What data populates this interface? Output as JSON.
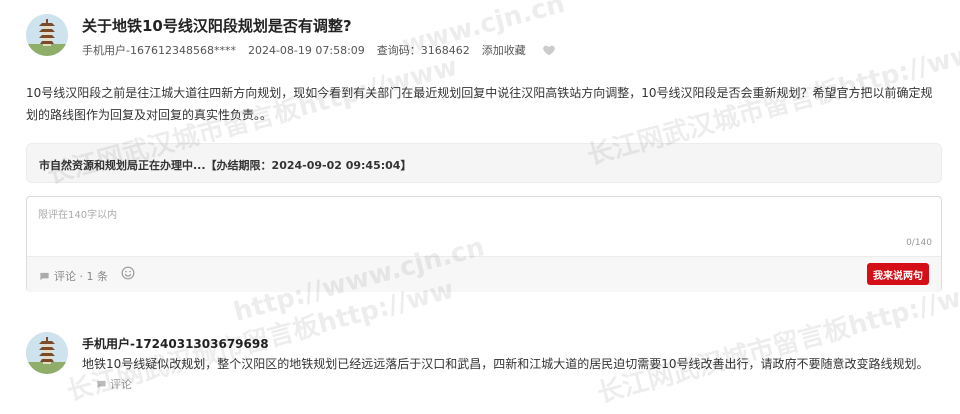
{
  "post": {
    "title": "关于地铁10号线汉阳段规划是否有调整?",
    "author": "手机用户-167612348568****",
    "date": "2024-08-19 07:58:09",
    "query_code_label": "查询码：",
    "query_code": "3168462",
    "favorite_label": "添加收藏",
    "body": "10号线汉阳段之前是往江城大道往四新方向规划，现如今看到有关部门在最近规划回复中说往汉阳高铁站方向调整，10号线汉阳段是否会重新规划？希望官方把以前确定规划的路线图作为回复及对回复的真实性负责。。",
    "status": "市自然资源和规划局正在办理中...【办结期限：2024-09-02 09:45:04】"
  },
  "comment_form": {
    "placeholder": "限评在140字以内",
    "value": "",
    "counter": "0/140",
    "comment_count": "评论 · 1 条",
    "submit_label": "我来说两句"
  },
  "replies": [
    {
      "user": "手机用户-1724031303679698",
      "text": "地铁10号线疑似改规划，整个汉阳区的地铁规划已经远远落后于汉口和武昌，四新和江城大道的居民迫切需要10号线改善出行，请政府不要随意改变路线规划。",
      "comment_label": "评论"
    }
  ],
  "watermarks": [
    "www.cjn.cn",
    "长江网武汉城市留言板http://www",
    "长江网武汉城市留言板http://www.",
    "长江网武汉城市留言板http://ww",
    "长江网武汉城市留言板http://www.",
    "http://www.cjn.cn"
  ],
  "colors": {
    "accent": "#d40f18",
    "panel": "#f5f5f5",
    "icon": "#bbbbbb"
  }
}
